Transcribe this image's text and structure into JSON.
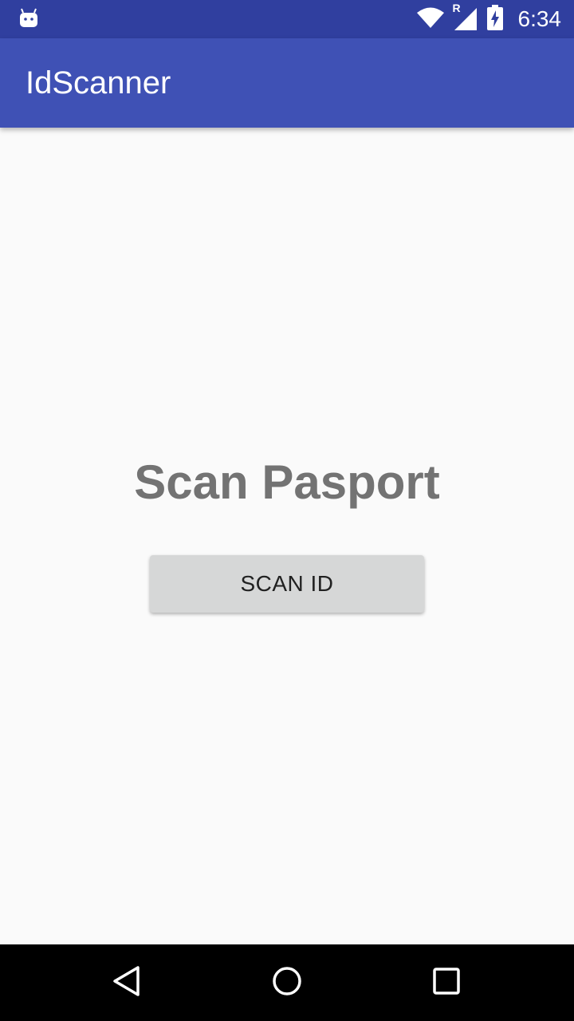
{
  "status_bar": {
    "time": "6:34",
    "network_label": "R",
    "icons": [
      "android-icon",
      "wifi-icon",
      "cell-signal-icon",
      "battery-charging-icon"
    ]
  },
  "app_bar": {
    "title": "IdScanner"
  },
  "main": {
    "headline": "Scan Pasport",
    "scan_button_label": "SCAN ID"
  },
  "nav_bar": {
    "icons": [
      "back-icon",
      "home-icon",
      "recents-icon"
    ]
  },
  "colors": {
    "status_bar": "#303f9f",
    "app_bar": "#3f51b5",
    "background": "#fafafa",
    "headline": "#737373",
    "button": "#d6d7d7",
    "nav_bar": "#000000"
  }
}
